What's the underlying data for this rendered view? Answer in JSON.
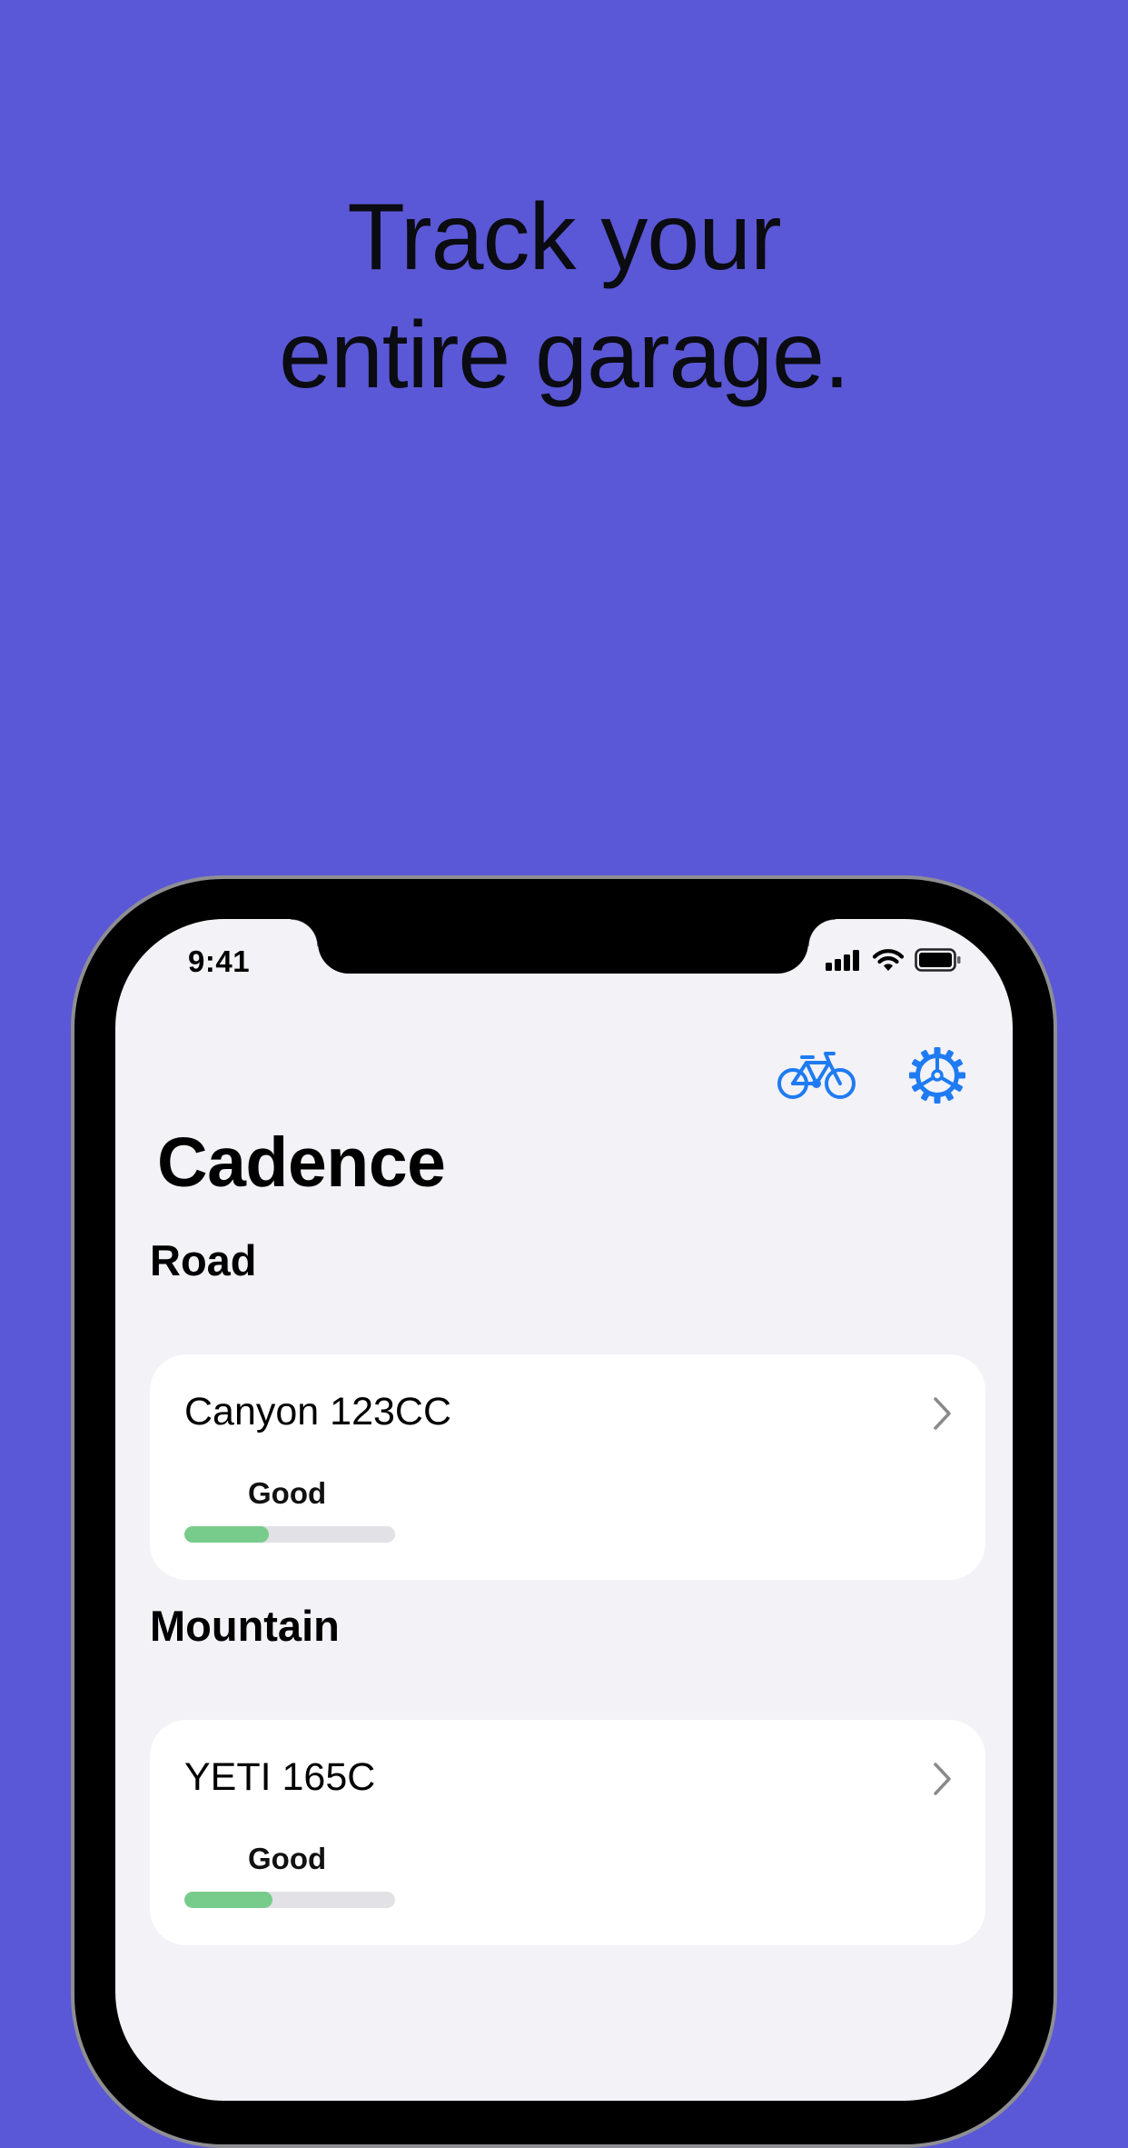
{
  "headline": {
    "line1": "Track your",
    "line2": "entire garage."
  },
  "status_bar": {
    "time": "9:41",
    "icons": [
      "cellular-signal-icon",
      "wifi-icon",
      "battery-icon"
    ]
  },
  "nav": {
    "icons": [
      "bicycle-icon",
      "gear-icon"
    ],
    "accent_color": "#1F7BF2"
  },
  "app": {
    "title": "Cadence"
  },
  "sections": [
    {
      "title": "Road",
      "bikes": [
        {
          "name": "Canyon 123CC",
          "condition": "Good",
          "wear_fraction": 0.4
        }
      ]
    },
    {
      "title": "Mountain",
      "bikes": [
        {
          "name": "YETI 165C",
          "condition": "Good",
          "wear_fraction": 0.42
        }
      ]
    }
  ],
  "colors": {
    "background": "#5A58D6",
    "screen": "#F2F2F7",
    "card": "#FFFFFF",
    "good_bar": "#78CC8B",
    "bar_track": "#E1E1E6",
    "accent": "#1F7BF2"
  }
}
